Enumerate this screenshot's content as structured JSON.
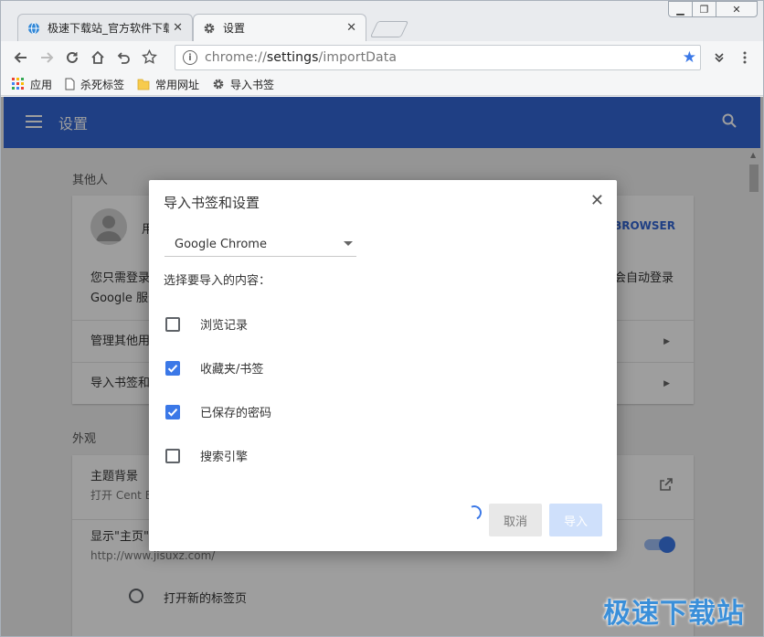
{
  "window": {
    "buttons": [
      "minimize",
      "restore",
      "close"
    ]
  },
  "tabs": [
    {
      "title": "极速下载站_官方软件下载",
      "icon": "site-globe-icon",
      "active": false
    },
    {
      "title": "设置",
      "icon": "gear-icon",
      "active": true
    }
  ],
  "toolbar": {
    "url_prefix": "chrome://",
    "url_path": "settings",
    "url_suffix": "/importData"
  },
  "bookmarks": [
    {
      "label": "应用",
      "icon": "apps-grid-icon"
    },
    {
      "label": "杀死标签",
      "icon": "page-icon"
    },
    {
      "label": "常用网址",
      "icon": "folder-icon"
    },
    {
      "label": "导入书签",
      "icon": "gear-icon"
    }
  ],
  "settings": {
    "title": "设置",
    "people_heading": "其他人",
    "people_name": "用",
    "browser_link": "BROWSER",
    "signin_text_1": "您只需登录",
    "signin_text_2": "Google 服务",
    "signin_right": "会自动登录",
    "manage_people": "管理其他用",
    "import_row": "导入书签和",
    "appearance_heading": "外观",
    "theme_label": "主题背景",
    "theme_sub": "打开 Cent B",
    "home_label": "显示\"主页\"",
    "home_sub": "http://www.jisuxz.com/",
    "newtab_radio": "打开新的标签页"
  },
  "dialog": {
    "title": "导入书签和设置",
    "browser_select": "Google Chrome",
    "prompt": "选择要导入的内容：",
    "options": [
      {
        "label": "浏览记录",
        "checked": false
      },
      {
        "label": "收藏夹/书签",
        "checked": true
      },
      {
        "label": "已保存的密码",
        "checked": true
      },
      {
        "label": "搜索引擎",
        "checked": false
      }
    ],
    "cancel_label": "取消",
    "import_label": "导入"
  },
  "watermark": "极速下载站",
  "colors": {
    "accent": "#3367d6",
    "checkbox": "#3b78e7"
  }
}
